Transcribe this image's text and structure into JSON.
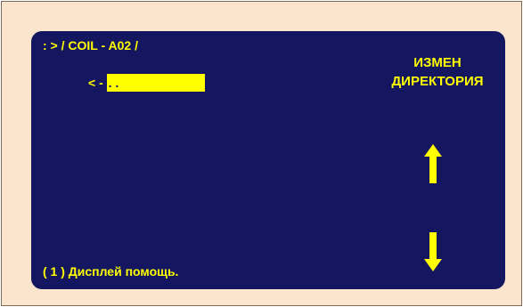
{
  "screen": {
    "path": ": > / COIL - A02 /",
    "dir_prefix": "< - ",
    "selected_entry": ". .",
    "menu_line1": "ИЗМЕН",
    "menu_line2": "ДИРЕКТОРИЯ",
    "help_text": "( 1 ) Дисплей помощь.",
    "up_icon": "arrow-up-icon",
    "down_icon": "arrow-down-icon"
  },
  "colors": {
    "frame_background": "#fce5cd",
    "screen_background": "#14175f",
    "text": "#ffff00",
    "highlight": "#ffff00"
  }
}
